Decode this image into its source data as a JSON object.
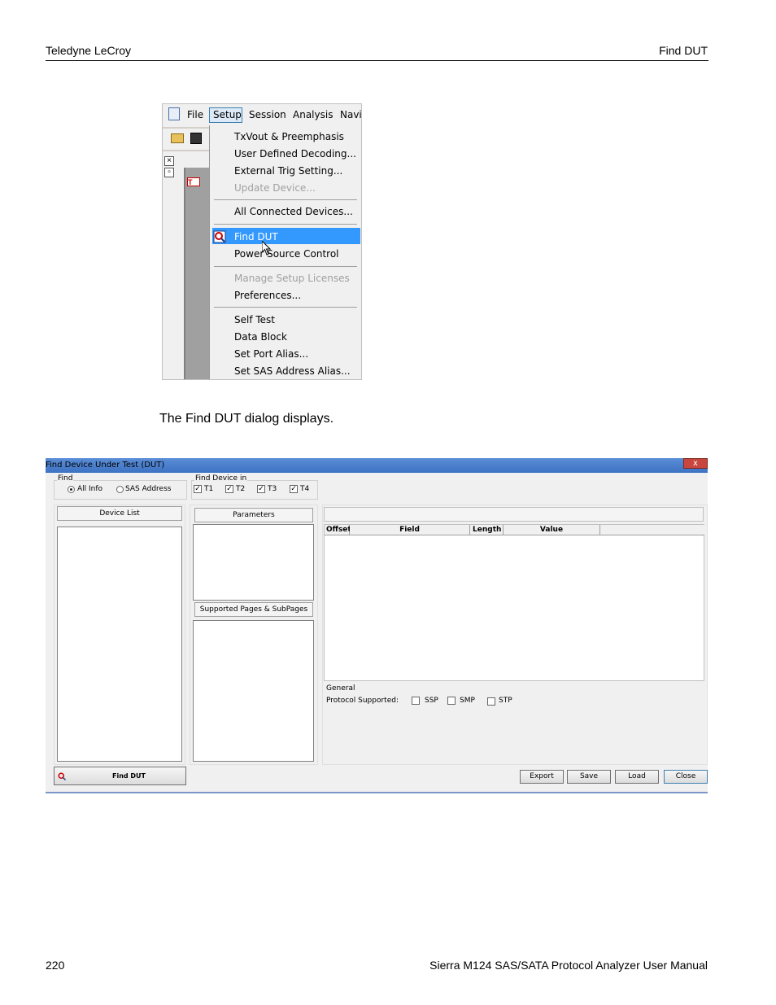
{
  "header": {
    "left": "Teledyne LeCroy",
    "right": "Find DUT"
  },
  "footer": {
    "page_number": "220",
    "title": "Sierra M124 SAS/SATA Protocol Analyzer User Manual"
  },
  "menu": {
    "bar": [
      "File",
      "Setup",
      "Session",
      "Analysis",
      "Navi"
    ],
    "items": [
      {
        "label": "TxVout & Preemphasis",
        "disabled": false
      },
      {
        "label": "User Defined Decoding...",
        "disabled": false
      },
      {
        "label": "External Trig Setting...",
        "disabled": false
      },
      {
        "label": "Update Device...",
        "disabled": true
      },
      {
        "label": "All Connected Devices...",
        "disabled": false
      },
      {
        "label": "Find DUT",
        "disabled": false,
        "highlighted": true
      },
      {
        "label": "Power Source Control",
        "disabled": false
      },
      {
        "label": "Manage Setup Licenses",
        "disabled": true
      },
      {
        "label": "Preferences...",
        "disabled": false
      },
      {
        "label": "Self Test",
        "disabled": false
      },
      {
        "label": "Data Block",
        "disabled": false
      },
      {
        "label": "Set Port Alias...",
        "disabled": false
      },
      {
        "label": "Set SAS Address Alias...",
        "disabled": false
      }
    ],
    "highlight_color": "#3399ff"
  },
  "caption": "The Find DUT dialog displays.",
  "dialog": {
    "title": "Find Device Under Test (DUT)",
    "close": "x",
    "find_group": {
      "label": "Find",
      "options": [
        "All Info",
        "SAS Address"
      ],
      "selected": "All Info"
    },
    "find_in_group": {
      "label": "Find Device in",
      "ports": [
        "T1",
        "T2",
        "T3",
        "T4"
      ],
      "checked": [
        true,
        true,
        true,
        true
      ]
    },
    "device_list": "Device List",
    "parameters": "Parameters",
    "supported_pages": "Supported Pages & SubPages",
    "columns": [
      "Offset",
      "Field",
      "Length",
      "Value"
    ],
    "general": {
      "label": "General",
      "protocol_label": "Protocol Supported:",
      "protocols": [
        "SSP",
        "SMP",
        "STP"
      ]
    },
    "find_button": "Find DUT",
    "buttons": [
      "Export",
      "Save",
      "Load",
      "Close"
    ]
  }
}
